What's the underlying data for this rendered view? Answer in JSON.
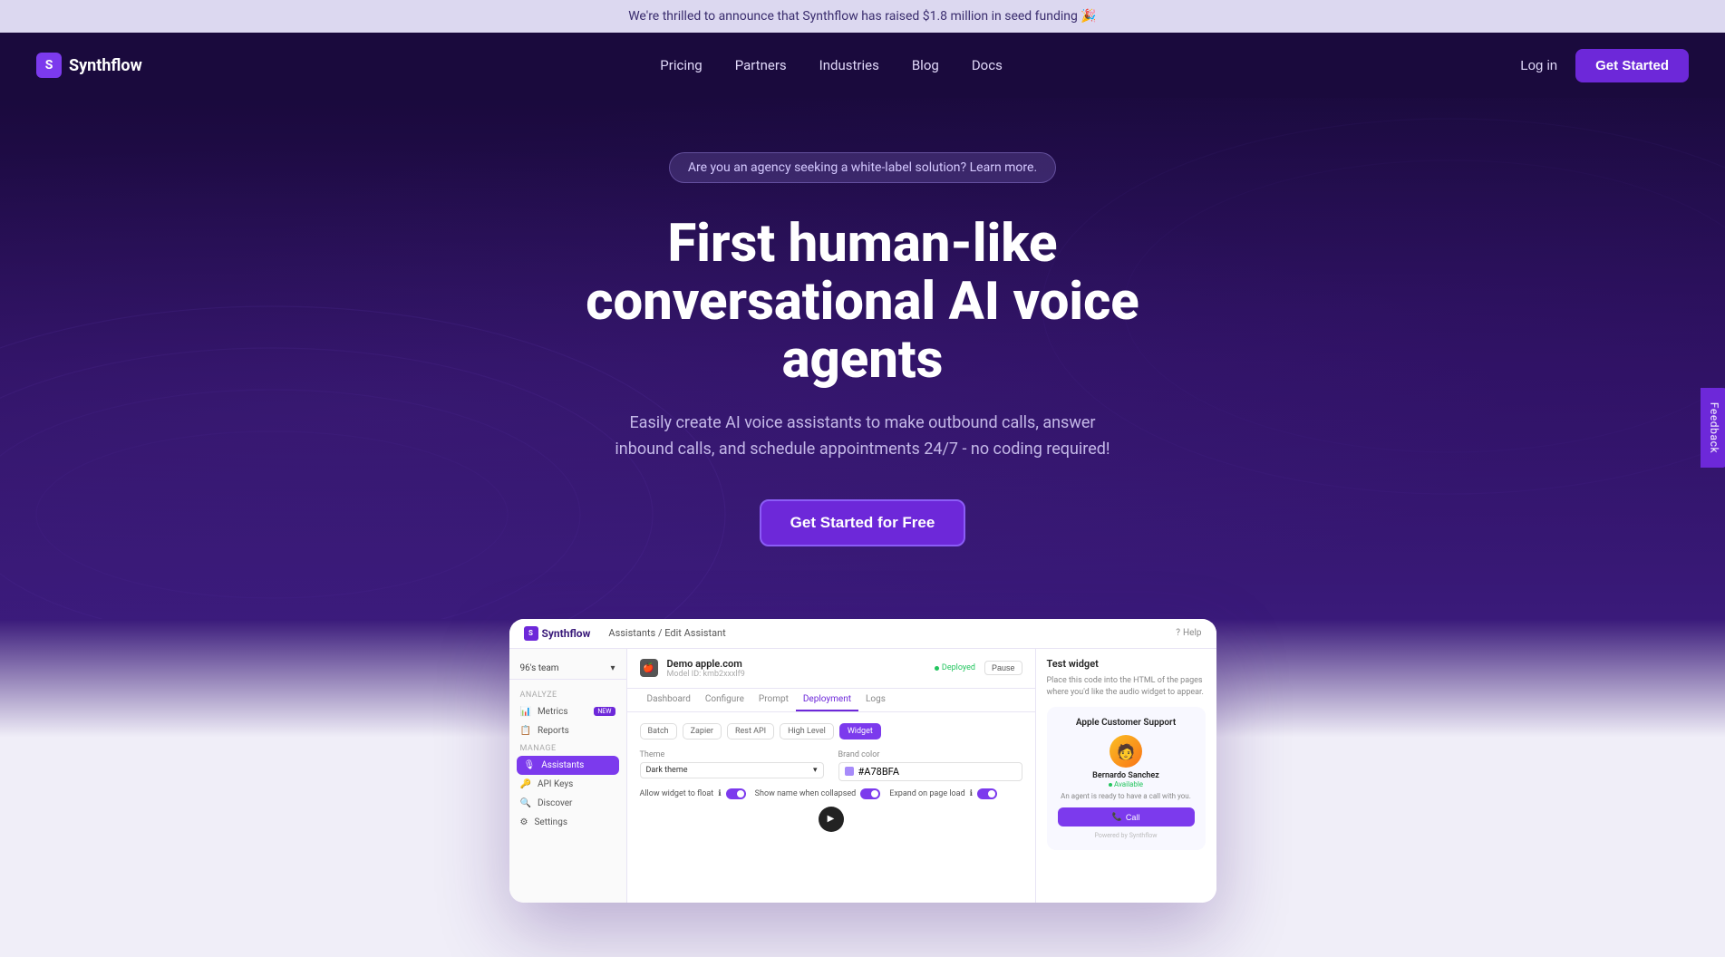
{
  "announcement": {
    "text": "We're thrilled to announce that Synthflow has raised $1.8 million in seed funding 🎉"
  },
  "navbar": {
    "logo_text": "Synthflow",
    "logo_icon": "S",
    "nav_items": [
      {
        "label": "Pricing",
        "href": "#"
      },
      {
        "label": "Partners",
        "href": "#"
      },
      {
        "label": "Industries",
        "href": "#"
      },
      {
        "label": "Blog",
        "href": "#"
      },
      {
        "label": "Docs",
        "href": "#"
      }
    ],
    "login_label": "Log in",
    "cta_label": "Get Started"
  },
  "hero": {
    "agency_badge": "Are you an agency seeking a white-label solution? Learn more.",
    "title_line1": "First human-like",
    "title_line2": "conversational AI voice agents",
    "subtitle": "Easily create AI voice assistants to make outbound calls, answer inbound calls, and schedule appointments 24/7 - no coding required!",
    "cta_label": "Get Started for Free"
  },
  "dashboard": {
    "logo": "Synthflow",
    "logo_icon": "S",
    "breadcrumb_parent": "Assistants",
    "breadcrumb_separator": "/",
    "breadcrumb_current": "Edit Assistant",
    "help_label": "Help",
    "team_name": "96's team",
    "sidebar_analyze_label": "ANALYZE",
    "sidebar_manage_label": "MANAGE",
    "sidebar_items": [
      {
        "label": "Metrics",
        "badge": "NEW",
        "icon": "📊",
        "active": false
      },
      {
        "label": "Reports",
        "icon": "📋",
        "active": false
      },
      {
        "label": "Assistants",
        "icon": "🎙",
        "active": true
      },
      {
        "label": "API Keys",
        "icon": "🔑",
        "active": false
      },
      {
        "label": "Discover",
        "icon": "🔍",
        "active": false
      },
      {
        "label": "Settings",
        "icon": "⚙",
        "active": false
      }
    ],
    "assistant_name": "Demo apple.com",
    "assistant_id": "Model ID: kmb2xxxlf9",
    "deployed_label": "Deployed",
    "pause_label": "Pause",
    "tabs": [
      "Dashboard",
      "Configure",
      "Prompt",
      "Deployment",
      "Logs"
    ],
    "active_tab": "Deployment",
    "sub_tabs": [
      "Batch",
      "Zapier",
      "Rest API",
      "High Level",
      "Widget"
    ],
    "active_sub_tab": "Widget",
    "theme_label": "Theme",
    "theme_value": "Dark theme",
    "brand_color_label": "Brand color",
    "brand_color_value": "#A78BFA",
    "float_label": "Allow widget to float",
    "show_name_label": "Show name when collapsed",
    "expand_label": "Expand on page load",
    "widget_title": "Test widget",
    "widget_desc": "Place this code into the HTML of the pages where you'd like the audio widget to appear.",
    "widget_preview_title": "Apple Customer Support",
    "agent_name": "Bernardo Sanchez",
    "agent_status": "Available",
    "agent_desc": "An agent is ready to have a call with you.",
    "call_btn_label": "Call",
    "powered_label": "Powered by",
    "powered_brand": "Synthflow"
  },
  "feedback": {
    "label": "Feedback"
  }
}
